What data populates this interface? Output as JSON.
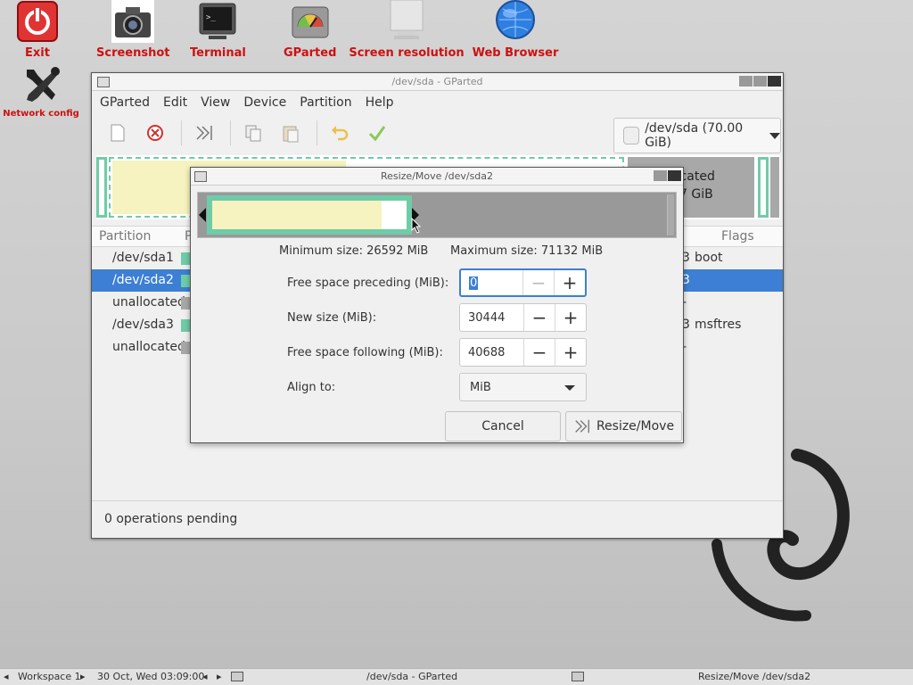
{
  "desktop": {
    "icons": [
      {
        "label": "Exit"
      },
      {
        "label": "Screenshot"
      },
      {
        "label": "Terminal"
      },
      {
        "label": "GParted"
      },
      {
        "label": "Screen resolution"
      },
      {
        "label": "Web Browser"
      },
      {
        "label": "Network config"
      }
    ]
  },
  "window": {
    "title": "/dev/sda - GParted",
    "menu": [
      "GParted",
      "Edit",
      "View",
      "Device",
      "Partition",
      "Help"
    ],
    "device": "/dev/sda (70.00 GiB)",
    "diskmap_right_text": [
      "ocated",
      "7 GiB"
    ],
    "columns": [
      "Partition",
      "P",
      "Flags"
    ],
    "rows": [
      {
        "name": "/dev/sda1",
        "color": "#6fcca8",
        "tail": "3",
        "flags": "boot"
      },
      {
        "name": "/dev/sda2",
        "color": "#6fcca8",
        "tail": "3",
        "flags": "",
        "selected": true
      },
      {
        "name": "unallocated",
        "color": "#a8a8a8",
        "tail": "-",
        "flags": ""
      },
      {
        "name": "/dev/sda3",
        "color": "#6fcca8",
        "tail": "3",
        "flags": "msftres"
      },
      {
        "name": "unallocated",
        "color": "#a8a8a8",
        "tail": "-",
        "flags": ""
      }
    ],
    "status": "0 operations pending"
  },
  "dialog": {
    "title": "Resize/Move /dev/sda2",
    "min_size": "Minimum size: 26592 MiB",
    "max_size": "Maximum size: 71132 MiB",
    "fields": {
      "free_preceding_label": "Free space preceding (MiB):",
      "free_preceding_value": "0",
      "new_size_label": "New size (MiB):",
      "new_size_value": "30444",
      "free_following_label": "Free space following (MiB):",
      "free_following_value": "40688",
      "align_label": "Align to:",
      "align_value": "MiB"
    },
    "cancel": "Cancel",
    "resize": "Resize/Move"
  },
  "taskbar": {
    "workspace": "Workspace 1",
    "datetime": "30 Oct, Wed 03:09:00",
    "task1": "/dev/sda - GParted",
    "task2": "Resize/Move /dev/sda2"
  },
  "colors": {
    "accent": "#3c7fd4",
    "partition_fill": "#6fcca8",
    "used_fill": "#f7f3c0",
    "unallocated": "#a8a8a8",
    "desktop_label": "#cc1111"
  }
}
